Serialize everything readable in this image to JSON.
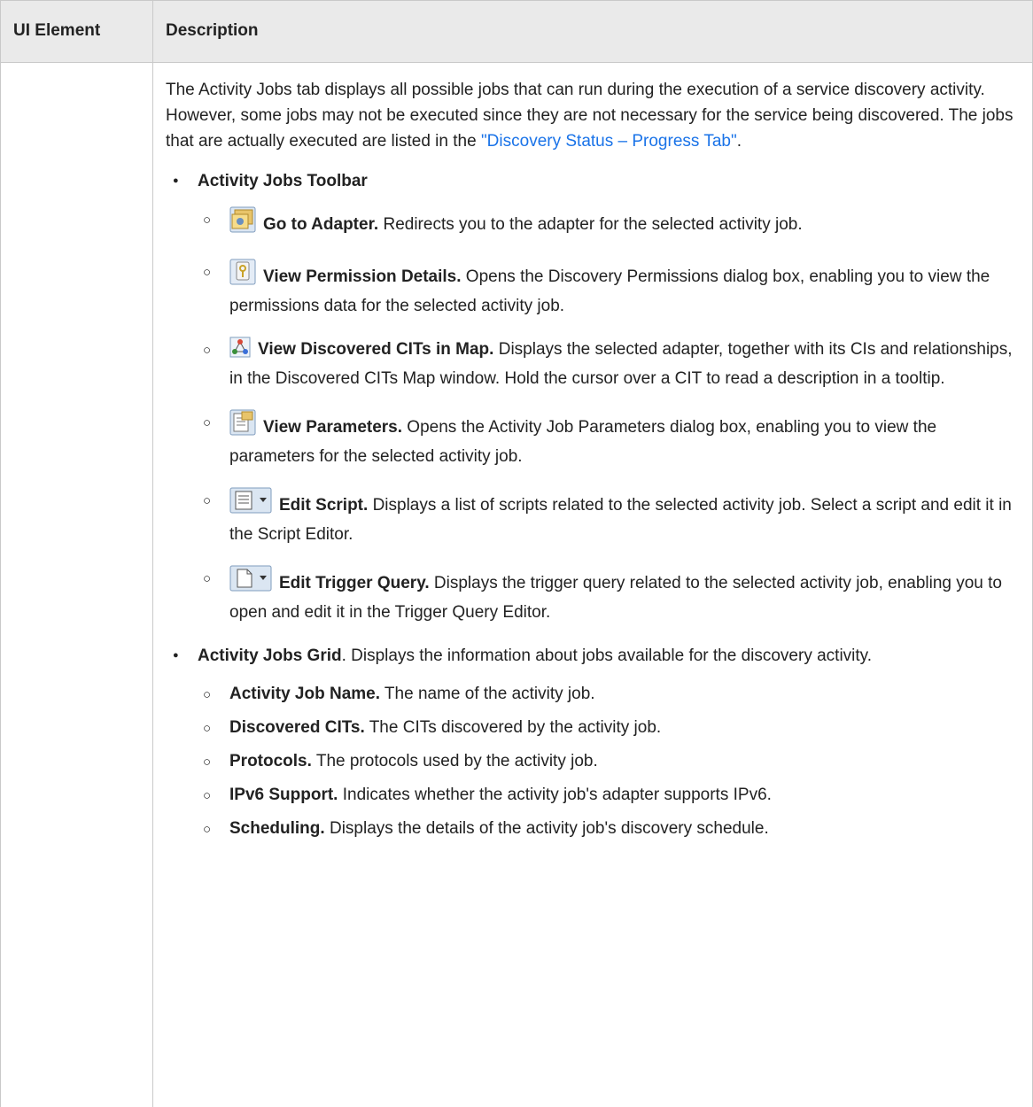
{
  "table": {
    "header": [
      "UI Element",
      "Description"
    ],
    "intro_text": "The Activity Jobs tab displays all possible jobs that can run during the execution of a service discovery activity. However, some jobs may not be executed since they are not necessary for the service being discovered. The jobs that are actually executed are listed in the ",
    "intro_link": "\"Discovery Status – Progress Tab\"",
    "intro_end": ".",
    "toolbar": {
      "title": "Activity Jobs Toolbar",
      "items": [
        {
          "label": "Go to Adapter.",
          "text": " Redirects you to the adapter for the selected activity job.",
          "icon": "adapter-icon"
        },
        {
          "label": "View Permission Details.",
          "text": " Opens the Discovery Permissions dialog box, enabling you to view the permissions data for the selected activity job.",
          "icon": "permission-icon"
        },
        {
          "label": "View Discovered CITs in Map.",
          "text": " Displays the selected adapter, together with its CIs and relationships, in the Discovered CITs Map window. Hold the cursor over a CIT to read a description in a tooltip.",
          "icon": "map-icon"
        },
        {
          "label": "View Parameters.",
          "text": " Opens the Activity Job Parameters dialog box, enabling you to view the parameters for the selected activity job.",
          "icon": "parameters-icon"
        },
        {
          "label": "Edit Script.",
          "text": " Displays a list of scripts related to the selected activity job. Select a script and edit it in the Script Editor.",
          "icon": "script-icon"
        },
        {
          "label": "Edit Trigger Query.",
          "text": " Displays the trigger query related to the selected activity job, enabling you to open and edit it in the Trigger Query Editor.",
          "icon": "trigger-query-icon"
        }
      ]
    },
    "grid": {
      "title": "Activity Jobs Grid",
      "text": ". Displays the information about jobs available for the discovery activity.",
      "items": [
        {
          "label": "Activity Job Name.",
          "text": " The name of the activity job."
        },
        {
          "label": "Discovered CITs.",
          "text": " The CITs discovered by the activity job."
        },
        {
          "label": "Protocols.",
          "text": " The protocols used by the activity job."
        },
        {
          "label": "IPv6 Support.",
          "text": " Indicates whether the activity job's adapter supports IPv6."
        },
        {
          "label": "Scheduling.",
          "text": " Displays the details of the activity job's discovery schedule."
        }
      ]
    }
  }
}
